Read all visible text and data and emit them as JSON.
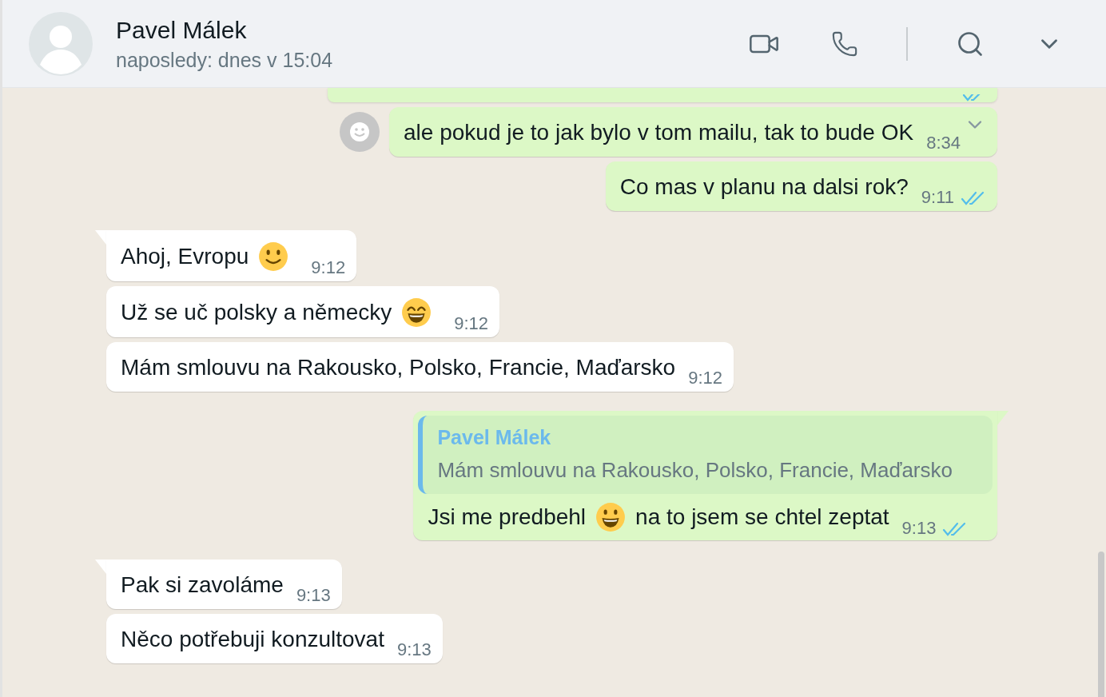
{
  "header": {
    "name": "Pavel Málek",
    "status": "naposledy: dnes v 15:04"
  },
  "messages": [
    {
      "kind": "out",
      "clipped": true,
      "read": true
    },
    {
      "kind": "out",
      "tail": false,
      "reaction_button": true,
      "menu_chevron": true,
      "parts": [
        {
          "kind": "text",
          "text": "ale pokud je to jak bylo v tom mailu, tak to bude OK"
        }
      ],
      "time": "8:34"
    },
    {
      "kind": "out",
      "tail": false,
      "parts": [
        {
          "kind": "text",
          "text": "Co mas v planu na dalsi rok?"
        }
      ],
      "time": "9:11",
      "read": true
    },
    {
      "kind": "in",
      "tail": true,
      "parts": [
        {
          "kind": "text",
          "text": "Ahoj, Evropu"
        },
        {
          "kind": "emoji_smile"
        }
      ],
      "time": "9:12"
    },
    {
      "kind": "in",
      "tail": false,
      "parts": [
        {
          "kind": "text",
          "text": "Už se uč polsky a německy"
        },
        {
          "kind": "emoji_grin"
        }
      ],
      "time": "9:12"
    },
    {
      "kind": "in",
      "tail": false,
      "parts": [
        {
          "kind": "text",
          "text": "Mám smlouvu na Rakousko, Polsko, Francie, Maďarsko"
        }
      ],
      "time": "9:12"
    },
    {
      "kind": "out",
      "tail": true,
      "quote": {
        "author": "Pavel Málek",
        "text": "Mám smlouvu na Rakousko, Polsko, Francie, Maďarsko"
      },
      "parts": [
        {
          "kind": "text",
          "text": "Jsi me predbehl"
        },
        {
          "kind": "emoji_grinning"
        },
        {
          "kind": "text",
          "text": "na to jsem se chtel zeptat"
        }
      ],
      "time": "9:13",
      "read": true
    },
    {
      "kind": "in",
      "tail": true,
      "parts": [
        {
          "kind": "text",
          "text": "Pak si zavoláme"
        }
      ],
      "time": "9:13"
    },
    {
      "kind": "in",
      "tail": false,
      "parts": [
        {
          "kind": "text",
          "text": "Něco potřebuji konzultovat"
        }
      ],
      "time": "9:13"
    }
  ]
}
